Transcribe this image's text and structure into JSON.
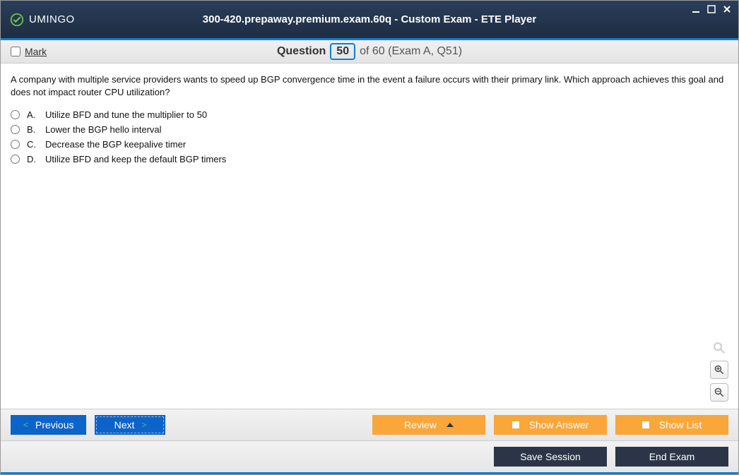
{
  "window": {
    "title": "300-420.prepaway.premium.exam.60q - Custom Exam - ETE Player",
    "brand": "UMINGO"
  },
  "question_header": {
    "mark_label": "Mark",
    "word": "Question",
    "number": "50",
    "suffix": "of 60 (Exam A, Q51)"
  },
  "question": {
    "text": "A company with multiple service providers wants to speed up BGP convergence time in the event a failure occurs with their primary link. Which approach achieves this goal and does not impact router CPU utilization?",
    "options": [
      {
        "letter": "A.",
        "text": "Utilize BFD and tune the multiplier to 50"
      },
      {
        "letter": "B.",
        "text": "Lower the BGP hello interval"
      },
      {
        "letter": "C.",
        "text": "Decrease the BGP keepalive timer"
      },
      {
        "letter": "D.",
        "text": "Utilize BFD and keep the default BGP timers"
      }
    ]
  },
  "footer": {
    "previous": "Previous",
    "next": "Next",
    "review": "Review",
    "show_answer": "Show Answer",
    "show_list": "Show List",
    "save_session": "Save Session",
    "end_exam": "End Exam"
  }
}
